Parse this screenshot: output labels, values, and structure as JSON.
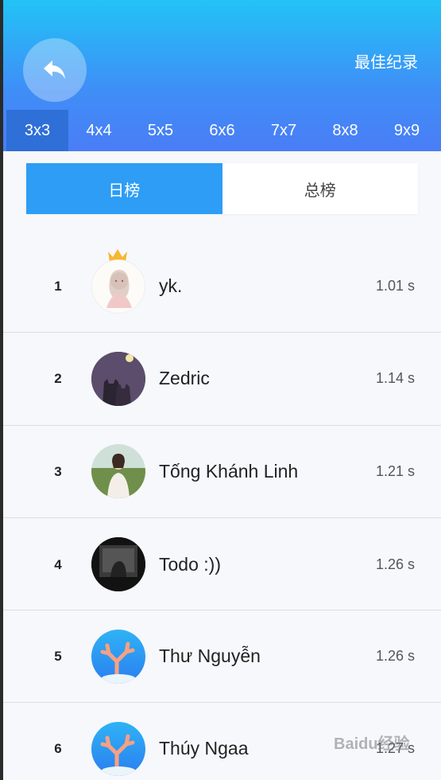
{
  "header": {
    "best_record_label": "最佳纪录",
    "size_tabs": [
      "3x3",
      "4x4",
      "5x5",
      "6x6",
      "7x7",
      "8x8",
      "9x9"
    ],
    "active_size": "3x3"
  },
  "rank_toggle": {
    "daily_label": "日榜",
    "total_label": "总榜",
    "active": "daily"
  },
  "leaderboard": [
    {
      "rank": "1",
      "name": "yk.",
      "time": "1.01 s",
      "avatar": "girl-sketch"
    },
    {
      "rank": "2",
      "name": "Zedric",
      "time": "1.14 s",
      "avatar": "night-cats"
    },
    {
      "rank": "3",
      "name": "Tống Khánh Linh",
      "time": "1.21 s",
      "avatar": "girl-field"
    },
    {
      "rank": "4",
      "name": "Todo :))",
      "time": "1.26 s",
      "avatar": "dark-window"
    },
    {
      "rank": "5",
      "name": "Thư Nguyễn",
      "time": "1.26 s",
      "avatar": "coral-default"
    },
    {
      "rank": "6",
      "name": "Thúy Ngaa",
      "time": "1.27 s",
      "avatar": "coral-default"
    }
  ],
  "watermark": "Baidu经验",
  "colors": {
    "header_top": "#22c3f6",
    "header_bottom": "#4a7df6",
    "active_tab": "#2f6fd8",
    "toggle_active": "#2d9df5",
    "crown": "#f7b731"
  },
  "icons": {
    "back": "back-arrow-icon",
    "crown": "crown-icon"
  }
}
